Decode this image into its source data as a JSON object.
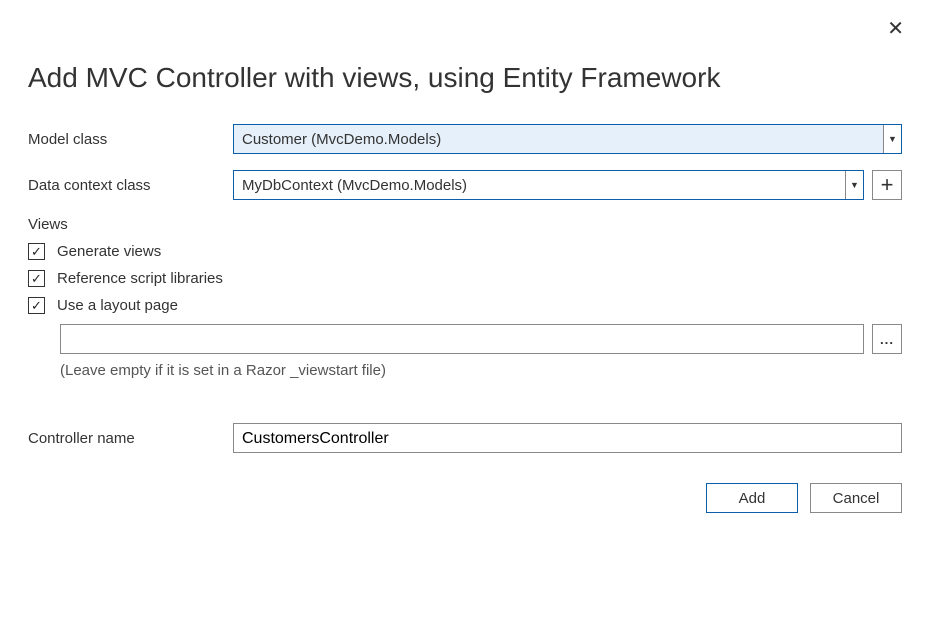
{
  "title": "Add MVC Controller with views, using Entity Framework",
  "labels": {
    "model_class": "Model class",
    "data_context_class": "Data context class",
    "views_section": "Views",
    "controller_name": "Controller name"
  },
  "fields": {
    "model_class": "Customer (MvcDemo.Models)",
    "data_context_class": "MyDbContext (MvcDemo.Models)",
    "layout_page": "",
    "controller_name": "CustomersController"
  },
  "checkboxes": {
    "generate_views": {
      "label": "Generate views",
      "checked": true
    },
    "reference_scripts": {
      "label": "Reference script libraries",
      "checked": true
    },
    "use_layout": {
      "label": "Use a layout page",
      "checked": true
    }
  },
  "hints": {
    "layout_empty": "(Leave empty if it is set in a Razor _viewstart file)"
  },
  "buttons": {
    "add": "Add",
    "cancel": "Cancel",
    "browse": "...",
    "plus": "+",
    "close": "✕"
  }
}
